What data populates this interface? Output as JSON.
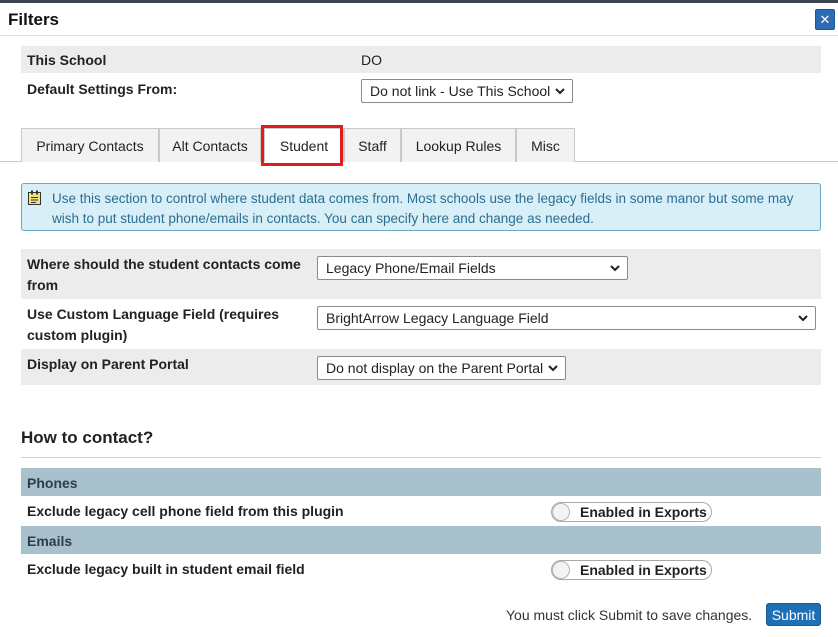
{
  "dialog": {
    "title": "Filters",
    "close_icon": "close-icon"
  },
  "school": {
    "label": "This School",
    "value": "DO"
  },
  "default_settings": {
    "label": "Default Settings From:",
    "selected": "Do not link - Use This School"
  },
  "tabs": [
    {
      "label": "Primary Contacts"
    },
    {
      "label": "Alt Contacts"
    },
    {
      "label": "Student",
      "active": true
    },
    {
      "label": "Staff"
    },
    {
      "label": "Lookup Rules"
    },
    {
      "label": "Misc"
    }
  ],
  "notice": {
    "icon": "note-icon",
    "text": "Use this section to control where student data comes from. Most schools use the legacy fields in some manor but some may wish to put student phone/emails in contacts. You can specify here and change as needed."
  },
  "settings": {
    "contacts_source": {
      "label": "Where should the student contacts come from",
      "selected": "Legacy Phone/Email Fields"
    },
    "language_field": {
      "label": "Use Custom Language Field (requires custom plugin)",
      "selected": "BrightArrow Legacy Language Field"
    },
    "parent_portal": {
      "label": "Display on Parent Portal",
      "selected": "Do not display on the Parent Portal"
    }
  },
  "how_to_contact": {
    "heading": "How to contact?",
    "phones": {
      "header": "Phones",
      "option_label": "Exclude legacy cell phone field from this plugin",
      "toggle_label": "Enabled in Exports"
    },
    "emails": {
      "header": "Emails",
      "option_label": "Exclude legacy built in student email field",
      "toggle_label": "Enabled in Exports"
    }
  },
  "footer": {
    "message": "You must click Submit to save changes.",
    "submit_label": "Submit"
  },
  "colors": {
    "accent": "#1f6fb6",
    "highlight": "#e21b1b",
    "notice_bg": "#d9eff8",
    "group_header_bg": "#a8c1cc"
  }
}
